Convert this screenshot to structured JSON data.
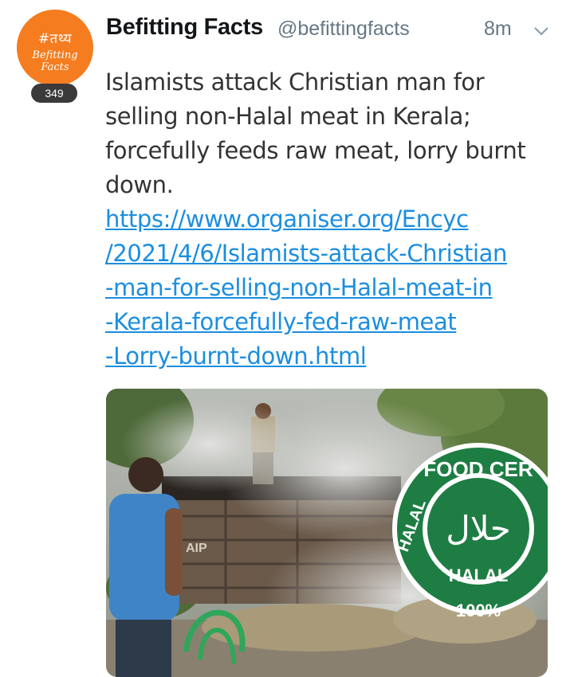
{
  "tweet": {
    "avatar": {
      "tag": "#तथ्य",
      "brand": "Befitting Facts",
      "bg": "#f57c1f"
    },
    "badge_count": "349",
    "author_name": "Befitting Facts",
    "author_handle": "@befittingfacts",
    "time": "8m",
    "text": "Islamists attack Christian man for selling non-Halal meat in Kerala; forcefully feeds raw meat, lorry burnt down.",
    "link_text": "https://www.organiser.org/Encyc\n/2021/4/6/Islamists-attack-Christian\n-man-for-selling-non-Halal-meat-in\n-Kerala-forcefully-fed-raw-meat\n-Lorry-burnt-down.html",
    "link_color": "#1b8ee0",
    "chevron_icon": "chevron-down-icon"
  },
  "media": {
    "truck_plate": "AIP",
    "seal_top": "FOOD CER",
    "seal_left": "HALAL",
    "seal_arabic": "حلال",
    "seal_center": "HALAL",
    "seal_bottom": "100%",
    "seal_color": "#1e7d43"
  }
}
